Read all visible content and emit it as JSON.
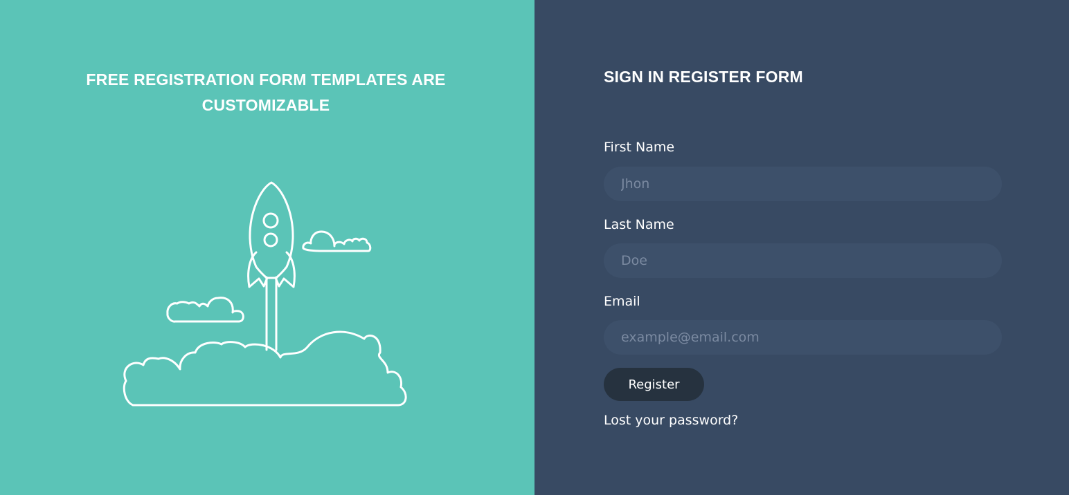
{
  "left": {
    "heading": "FREE REGISTRATION FORM TEMPLATES ARE CUSTOMIZABLE",
    "illustration": "rocket-launch-icon"
  },
  "form": {
    "title": "SIGN IN REGISTER FORM",
    "first_name": {
      "label": "First Name",
      "placeholder": "Jhon",
      "value": ""
    },
    "last_name": {
      "label": "Last Name",
      "placeholder": "Doe",
      "value": ""
    },
    "email": {
      "label": "Email",
      "placeholder": "example@email.com",
      "value": ""
    },
    "register_label": "Register",
    "lost_password_label": "Lost your password?"
  },
  "colors": {
    "left_background": "#5bc4b7",
    "right_background": "#384a63",
    "input_background": "#3d506a",
    "button_background": "#26323f",
    "text": "#ffffff"
  }
}
